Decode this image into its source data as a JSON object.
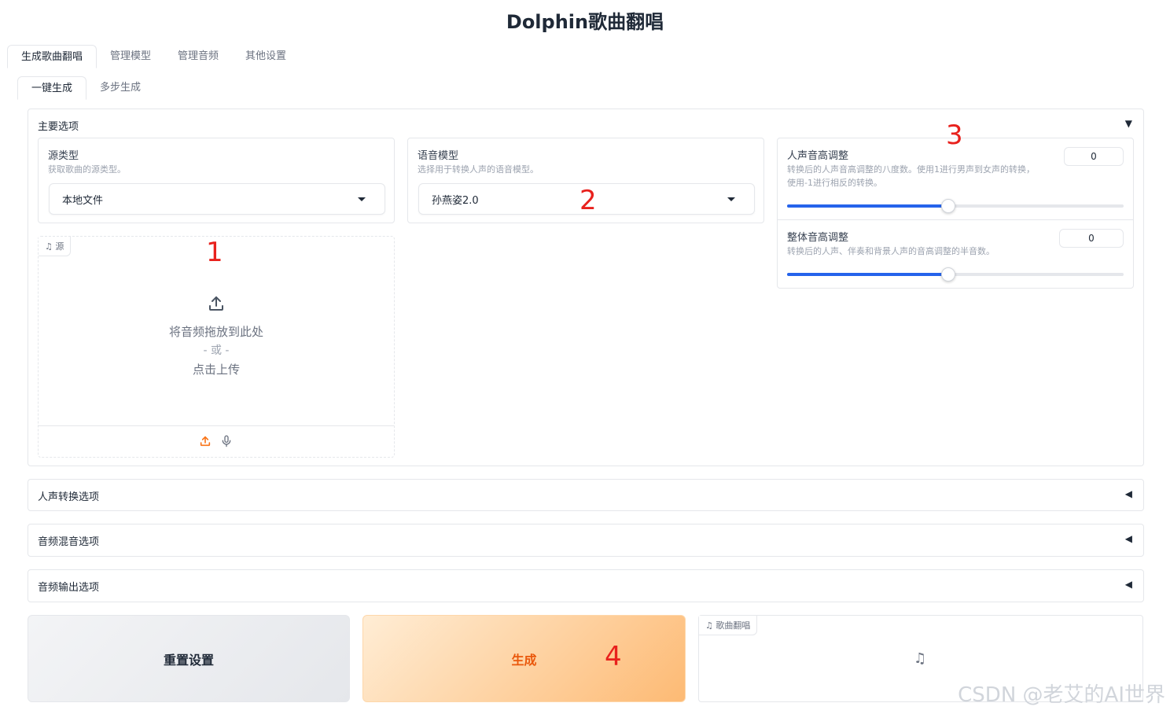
{
  "app": {
    "title": "Dolphin歌曲翻唱"
  },
  "main_tabs": [
    {
      "label": "生成歌曲翻唱",
      "active": true
    },
    {
      "label": "管理模型",
      "active": false
    },
    {
      "label": "管理音频",
      "active": false
    },
    {
      "label": "其他设置",
      "active": false
    }
  ],
  "sub_tabs": [
    {
      "label": "一键生成",
      "active": true
    },
    {
      "label": "多步生成",
      "active": false
    }
  ],
  "main_options": {
    "title": "主要选项",
    "arrow": "▼",
    "source_type": {
      "label": "源类型",
      "info": "获取歌曲的源类型。",
      "value": "本地文件"
    },
    "voice_model": {
      "label": "语音模型",
      "info": "选择用于转换人声的语音模型。",
      "value": "孙燕姿2.0"
    },
    "vocal_pitch": {
      "label": "人声音高调整",
      "info_line1": "转换后的人声音高调整的八度数。使用1进行男声到女声的转换，",
      "info_line2": "使用-1进行相反的转换。",
      "value": "0",
      "level": 0.48
    },
    "overall_pitch": {
      "label": "整体音高调整",
      "info": "转换后的人声、伴奏和背景人声的音高调整的半音数。",
      "value": "0",
      "level": 0.48
    },
    "upload": {
      "label": "源",
      "drop_text": "将音频拖放到此处",
      "or_text": "- 或 -",
      "click_text": "点击上传"
    }
  },
  "accordions": [
    {
      "title": "人声转换选项",
      "arrow": "◀"
    },
    {
      "title": "音频混音选项",
      "arrow": "◀"
    },
    {
      "title": "音频输出选项",
      "arrow": "◀"
    }
  ],
  "buttons": {
    "reset": "重置设置",
    "generate": "生成"
  },
  "output": {
    "label": "歌曲翻唱"
  },
  "markers": [
    "1",
    "2",
    "3",
    "4"
  ],
  "watermark": "CSDN @老艾的AI世界",
  "colors": {
    "accent_blue": "#2563eb",
    "generate_text": "#ea580c",
    "marker_red": "#e8211d"
  }
}
